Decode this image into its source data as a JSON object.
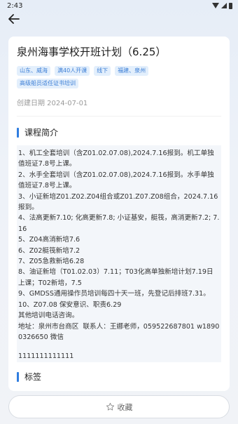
{
  "status": {
    "time": "2:43"
  },
  "course": {
    "title": "泉州海事学校开班计划（6.25）",
    "tags": [
      "山东、威海",
      "满40人开课",
      "线下",
      "福建、泉州",
      "高级船员适任证书培训"
    ],
    "created": "创建日期 2024-07-01"
  },
  "intro": {
    "heading": "课程简介",
    "lines": [
      "1、机工全套培训（含Z01.02.07.08),2024.7.16报到。机工单独值班证7.8号上课。",
      "2、水手全套培训（含Z01.02.07.08),2024.7.16报到。水手单独值班证7.8号上课。",
      "3、小证新培Z01.Z02.Z04组合或Z01.Z07.Z08组合，2024.7.16报到。",
      "4、法高更新7.10; 化高更新7.8; 小证基安，艇筏，高消更新7.2; 7.16",
      "5、Z04高消新培7.6",
      "6、Z02艇筏新培7.2",
      "7、Z05急救新培6.28",
      "8、油证新培（T01.02.03）7.11；T03化高单独新培计划7.19日上课；T02新培，7.5",
      "9、GMDSS通用操作员培训每四十天一班，先登记后排班7.31。",
      "10、Z07.08 保安意识、职责6.29",
      "其他培训电话咨询。",
      "地址：泉州市台商区  联系人：王娜老师，059522687801 w18900326650 微信"
    ],
    "extra": "1111111111111"
  },
  "tags_section": {
    "heading": "标签"
  },
  "footer": {
    "favorite_label": "收藏"
  }
}
